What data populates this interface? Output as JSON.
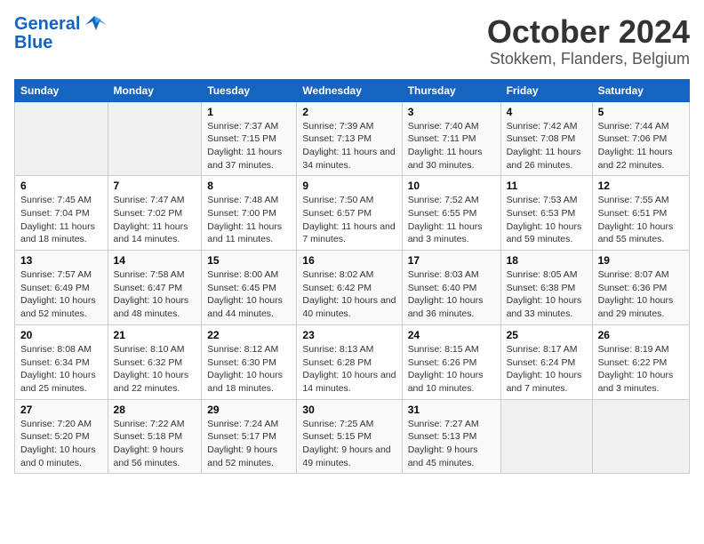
{
  "logo": {
    "text_general": "General",
    "text_blue": "Blue"
  },
  "title": "October 2024",
  "subtitle": "Stokkem, Flanders, Belgium",
  "days_header": [
    "Sunday",
    "Monday",
    "Tuesday",
    "Wednesday",
    "Thursday",
    "Friday",
    "Saturday"
  ],
  "weeks": [
    [
      {
        "day": "",
        "empty": true
      },
      {
        "day": "",
        "empty": true
      },
      {
        "day": "1",
        "sunrise": "Sunrise: 7:37 AM",
        "sunset": "Sunset: 7:15 PM",
        "daylight": "Daylight: 11 hours and 37 minutes."
      },
      {
        "day": "2",
        "sunrise": "Sunrise: 7:39 AM",
        "sunset": "Sunset: 7:13 PM",
        "daylight": "Daylight: 11 hours and 34 minutes."
      },
      {
        "day": "3",
        "sunrise": "Sunrise: 7:40 AM",
        "sunset": "Sunset: 7:11 PM",
        "daylight": "Daylight: 11 hours and 30 minutes."
      },
      {
        "day": "4",
        "sunrise": "Sunrise: 7:42 AM",
        "sunset": "Sunset: 7:08 PM",
        "daylight": "Daylight: 11 hours and 26 minutes."
      },
      {
        "day": "5",
        "sunrise": "Sunrise: 7:44 AM",
        "sunset": "Sunset: 7:06 PM",
        "daylight": "Daylight: 11 hours and 22 minutes."
      }
    ],
    [
      {
        "day": "6",
        "sunrise": "Sunrise: 7:45 AM",
        "sunset": "Sunset: 7:04 PM",
        "daylight": "Daylight: 11 hours and 18 minutes."
      },
      {
        "day": "7",
        "sunrise": "Sunrise: 7:47 AM",
        "sunset": "Sunset: 7:02 PM",
        "daylight": "Daylight: 11 hours and 14 minutes."
      },
      {
        "day": "8",
        "sunrise": "Sunrise: 7:48 AM",
        "sunset": "Sunset: 7:00 PM",
        "daylight": "Daylight: 11 hours and 11 minutes."
      },
      {
        "day": "9",
        "sunrise": "Sunrise: 7:50 AM",
        "sunset": "Sunset: 6:57 PM",
        "daylight": "Daylight: 11 hours and 7 minutes."
      },
      {
        "day": "10",
        "sunrise": "Sunrise: 7:52 AM",
        "sunset": "Sunset: 6:55 PM",
        "daylight": "Daylight: 11 hours and 3 minutes."
      },
      {
        "day": "11",
        "sunrise": "Sunrise: 7:53 AM",
        "sunset": "Sunset: 6:53 PM",
        "daylight": "Daylight: 10 hours and 59 minutes."
      },
      {
        "day": "12",
        "sunrise": "Sunrise: 7:55 AM",
        "sunset": "Sunset: 6:51 PM",
        "daylight": "Daylight: 10 hours and 55 minutes."
      }
    ],
    [
      {
        "day": "13",
        "sunrise": "Sunrise: 7:57 AM",
        "sunset": "Sunset: 6:49 PM",
        "daylight": "Daylight: 10 hours and 52 minutes."
      },
      {
        "day": "14",
        "sunrise": "Sunrise: 7:58 AM",
        "sunset": "Sunset: 6:47 PM",
        "daylight": "Daylight: 10 hours and 48 minutes."
      },
      {
        "day": "15",
        "sunrise": "Sunrise: 8:00 AM",
        "sunset": "Sunset: 6:45 PM",
        "daylight": "Daylight: 10 hours and 44 minutes."
      },
      {
        "day": "16",
        "sunrise": "Sunrise: 8:02 AM",
        "sunset": "Sunset: 6:42 PM",
        "daylight": "Daylight: 10 hours and 40 minutes."
      },
      {
        "day": "17",
        "sunrise": "Sunrise: 8:03 AM",
        "sunset": "Sunset: 6:40 PM",
        "daylight": "Daylight: 10 hours and 36 minutes."
      },
      {
        "day": "18",
        "sunrise": "Sunrise: 8:05 AM",
        "sunset": "Sunset: 6:38 PM",
        "daylight": "Daylight: 10 hours and 33 minutes."
      },
      {
        "day": "19",
        "sunrise": "Sunrise: 8:07 AM",
        "sunset": "Sunset: 6:36 PM",
        "daylight": "Daylight: 10 hours and 29 minutes."
      }
    ],
    [
      {
        "day": "20",
        "sunrise": "Sunrise: 8:08 AM",
        "sunset": "Sunset: 6:34 PM",
        "daylight": "Daylight: 10 hours and 25 minutes."
      },
      {
        "day": "21",
        "sunrise": "Sunrise: 8:10 AM",
        "sunset": "Sunset: 6:32 PM",
        "daylight": "Daylight: 10 hours and 22 minutes."
      },
      {
        "day": "22",
        "sunrise": "Sunrise: 8:12 AM",
        "sunset": "Sunset: 6:30 PM",
        "daylight": "Daylight: 10 hours and 18 minutes."
      },
      {
        "day": "23",
        "sunrise": "Sunrise: 8:13 AM",
        "sunset": "Sunset: 6:28 PM",
        "daylight": "Daylight: 10 hours and 14 minutes."
      },
      {
        "day": "24",
        "sunrise": "Sunrise: 8:15 AM",
        "sunset": "Sunset: 6:26 PM",
        "daylight": "Daylight: 10 hours and 10 minutes."
      },
      {
        "day": "25",
        "sunrise": "Sunrise: 8:17 AM",
        "sunset": "Sunset: 6:24 PM",
        "daylight": "Daylight: 10 hours and 7 minutes."
      },
      {
        "day": "26",
        "sunrise": "Sunrise: 8:19 AM",
        "sunset": "Sunset: 6:22 PM",
        "daylight": "Daylight: 10 hours and 3 minutes."
      }
    ],
    [
      {
        "day": "27",
        "sunrise": "Sunrise: 7:20 AM",
        "sunset": "Sunset: 5:20 PM",
        "daylight": "Daylight: 10 hours and 0 minutes."
      },
      {
        "day": "28",
        "sunrise": "Sunrise: 7:22 AM",
        "sunset": "Sunset: 5:18 PM",
        "daylight": "Daylight: 9 hours and 56 minutes."
      },
      {
        "day": "29",
        "sunrise": "Sunrise: 7:24 AM",
        "sunset": "Sunset: 5:17 PM",
        "daylight": "Daylight: 9 hours and 52 minutes."
      },
      {
        "day": "30",
        "sunrise": "Sunrise: 7:25 AM",
        "sunset": "Sunset: 5:15 PM",
        "daylight": "Daylight: 9 hours and 49 minutes."
      },
      {
        "day": "31",
        "sunrise": "Sunrise: 7:27 AM",
        "sunset": "Sunset: 5:13 PM",
        "daylight": "Daylight: 9 hours and 45 minutes."
      },
      {
        "day": "",
        "empty": true
      },
      {
        "day": "",
        "empty": true
      }
    ]
  ]
}
